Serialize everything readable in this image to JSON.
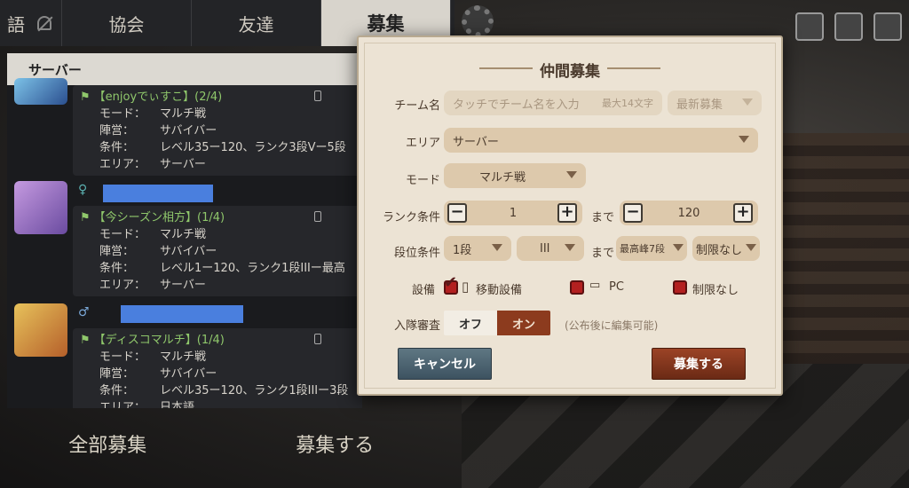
{
  "tabs": {
    "lang": "語",
    "items": [
      {
        "label": "協会"
      },
      {
        "label": "友達"
      },
      {
        "label": "募集"
      }
    ]
  },
  "panel": {
    "server_label": "サーバー",
    "entries": [
      {
        "title": "【enjoyでぃすこ】(2/4)",
        "mode_key": "モード：",
        "mode": "マルチ戦",
        "camp_key": "陣営：",
        "camp": "サバイバー",
        "cond_key": "条件：",
        "cond": "レベル35ー120、ランク3段Vー5段",
        "area_key": "エリア：",
        "area": "サーバー"
      },
      {
        "title": "【今シーズン相方】(1/4)",
        "mode_key": "モード：",
        "mode": "マルチ戦",
        "camp_key": "陣営：",
        "camp": "サバイバー",
        "cond_key": "条件：",
        "cond": "レベル1ー120、ランク1段IIIー最高",
        "area_key": "エリア：",
        "area": "サーバー"
      },
      {
        "title": "【ディスコマルチ】(1/4)",
        "mode_key": "モード：",
        "mode": "マルチ戦",
        "camp_key": "陣営：",
        "camp": "サバイバー",
        "cond_key": "条件：",
        "cond": "レベル35ー120、ランク1段IIIー3段",
        "area_key": "エリア：",
        "area": "日本語"
      }
    ]
  },
  "bottom": {
    "all_label": "全部募集",
    "recruit_label": "募集する"
  },
  "modal": {
    "title": "仲間募集",
    "team_label": "チーム名",
    "team_placeholder": "タッチでチーム名を入力",
    "team_limit": "最大14文字",
    "latest": "最新募集",
    "area_label": "エリア",
    "area_value": "サーバー",
    "mode_label": "モード",
    "mode_value": "マルチ戦",
    "rank_label": "ランク条件",
    "rank_min": "1",
    "rank_to": "まで",
    "rank_max": "120",
    "tier_label": "段位条件",
    "tier_min": "1段",
    "tier_sub": "III",
    "tier_to": "まで",
    "tier_max": "最高峰7段",
    "tier_limit": "制限なし",
    "device_label": "設備",
    "dev_mobile": "移動設備",
    "dev_pc": "PC",
    "dev_none": "制限なし",
    "review_label": "入隊審査",
    "review_off": "オフ",
    "review_on": "オン",
    "review_note": "(公布後に編集可能)",
    "cancel": "キャンセル",
    "submit": "募集する"
  }
}
